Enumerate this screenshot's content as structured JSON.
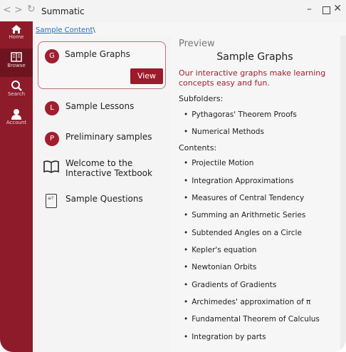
{
  "window": {
    "title": "Summatic",
    "back_glyph": "<",
    "forward_glyph": ">",
    "refresh_glyph": "↻",
    "min_glyph": "–",
    "close_glyph": "✕"
  },
  "rail": {
    "items": [
      {
        "label": "Home",
        "icon": "home-icon",
        "glyph": "⌂"
      },
      {
        "label": "Browse",
        "icon": "browse-icon",
        "glyph": "▤"
      },
      {
        "label": "Search",
        "icon": "search-icon",
        "glyph": "⚲"
      },
      {
        "label": "Account",
        "icon": "account-icon",
        "glyph": "●"
      }
    ],
    "active": "Browse",
    "color": "#8e1b29"
  },
  "breadcrumb": {
    "link": "Sample Content",
    "sep": "\\"
  },
  "list": {
    "items": [
      {
        "badge": "G",
        "title": "Sample Graphs",
        "selected": true
      },
      {
        "badge": "L",
        "title": "Sample Lessons"
      },
      {
        "badge": "P",
        "title": "Preliminary samples"
      },
      {
        "icon": "book-icon",
        "title": "Welcome to the",
        "title2": "Interactive Textbook"
      },
      {
        "icon": "question-sheet-icon",
        "title": "Sample Questions",
        "icon_text": "≡?"
      }
    ],
    "view_label": "View"
  },
  "preview": {
    "label": "Preview",
    "title": "Sample Graphs",
    "description": "Our interactive graphs make learning concepts easy and fun.",
    "subfolders_heading": "Subfolders:",
    "subfolders": [
      "Pythagoras' Theorem Proofs",
      "Numerical Methods"
    ],
    "contents_heading": "Contents:",
    "contents": [
      "Projectile Motion",
      "Integration Approximations",
      "Measures of Central Tendency",
      "Summing an Arithmetic Series",
      "Subtended Angles on a Circle",
      "Kepler's equation",
      "Newtonian Orbits",
      "Gradients of Gradients",
      "Archimedes' approximation of π",
      "Fundamental Theorem of Calculus",
      "Integration by parts"
    ]
  },
  "colors": {
    "accent": "#a01e2e",
    "rail": "#8e1b29"
  }
}
